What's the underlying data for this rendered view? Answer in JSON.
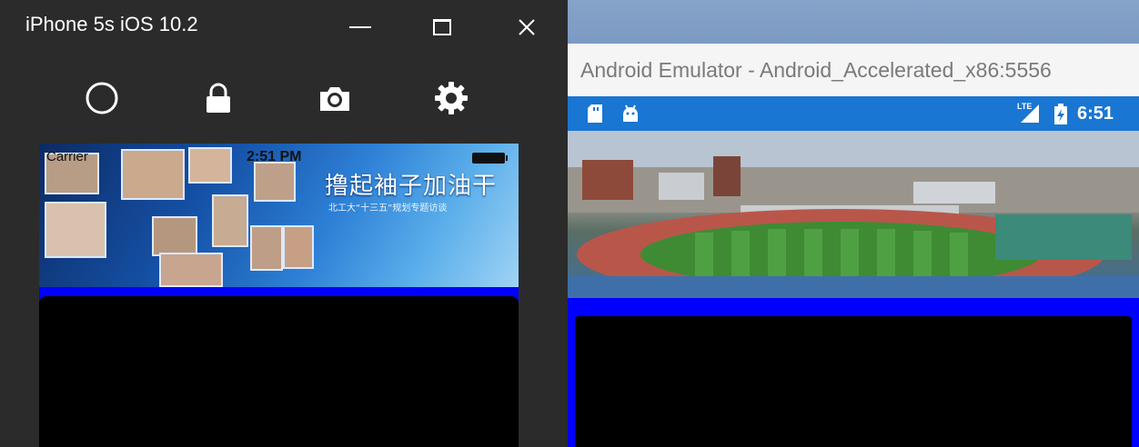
{
  "ios": {
    "window_title": "iPhone 5s iOS 10.2",
    "status": {
      "carrier": "Carrier",
      "time": "2:51 PM"
    },
    "banner": {
      "title": "撸起袖子加油干",
      "subtitle": "北工大“十三五”规划专题访谈"
    },
    "toolbar_icons": [
      "home-icon",
      "lock-icon",
      "camera-icon",
      "gear-icon"
    ]
  },
  "android": {
    "window_title": "Android Emulator - Android_Accelerated_x86:5556",
    "status": {
      "network": "LTE",
      "time": "6:51"
    }
  },
  "colors": {
    "ios_chrome": "#2b2b2b",
    "content_blue": "#0000ff",
    "android_statusbar": "#1976d2"
  }
}
